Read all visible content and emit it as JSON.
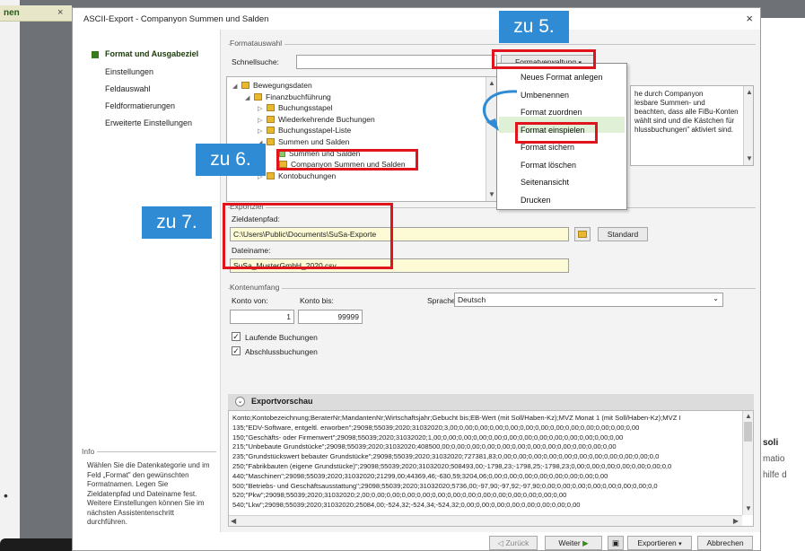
{
  "background_app": {
    "tab_label": "nen",
    "tab_close": "×",
    "right_texts": [
      "soli",
      "matio",
      "hilfe d"
    ]
  },
  "dialog": {
    "title": "ASCII-Export - Companyon Summen und Salden",
    "close": "×"
  },
  "nav": {
    "items": [
      "Format und Ausgabeziel",
      "Einstellungen",
      "Feldauswahl",
      "Feldformatierungen",
      "Erweiterte Einstellungen"
    ],
    "info_title": "Info",
    "info_text": "Wählen Sie die Datenkategorie und im Feld „Format\" den gewünschten Formatnamen. Legen Sie Zieldatenpfad und Dateiname fest. Weitere Einstellungen können Sie im nächsten Assistentenschritt durchführen."
  },
  "format_group": {
    "title": "Formatauswahl",
    "quicksearch_label": "Schnellsuche:",
    "quicksearch_value": "",
    "manager_button": "Formatverwaltung",
    "tree": [
      {
        "label": "Bewegungsdaten",
        "level": 0,
        "icon": "folder",
        "tri": "◢"
      },
      {
        "label": "Finanzbuchführung",
        "level": 1,
        "icon": "folder",
        "tri": "◢"
      },
      {
        "label": "Buchungsstapel",
        "level": 2,
        "icon": "folder",
        "tri": "▷"
      },
      {
        "label": "Wiederkehrende Buchungen",
        "level": 2,
        "icon": "folder",
        "tri": "▷"
      },
      {
        "label": "Buchungsstapel-Liste",
        "level": 2,
        "icon": "folder",
        "tri": "▷"
      },
      {
        "label": "Summen und Salden",
        "level": 2,
        "icon": "folder",
        "tri": "◢"
      },
      {
        "label": "Summen und Salden",
        "level": 3,
        "icon": "doc",
        "tri": ""
      },
      {
        "label": "Companyon Summen und Salden",
        "level": 3,
        "icon": "folder",
        "tri": ""
      },
      {
        "label": "Kontobuchungen",
        "level": 2,
        "icon": "folder",
        "tri": "▷"
      }
    ],
    "description_lines": [
      "he durch Companyon",
      "lesbare Summen- und",
      "beachten, dass alle FiBu-Konten",
      "wählt sind und die Kästchen für",
      "hlussbuchungen\" aktiviert sind."
    ]
  },
  "menu": {
    "items": [
      "Neues Format anlegen",
      "Umbenennen",
      "Format zuordnen",
      "Format einspielen",
      "Format sichern",
      "Format löschen",
      "Seitenansicht",
      "Drucken"
    ]
  },
  "export_group": {
    "title": "Exportziel",
    "path_label": "Zieldatenpfad:",
    "path_value": "C:\\Users\\Public\\Documents\\SuSa-Exporte",
    "standard_button": "Standard",
    "filename_label": "Dateiname:",
    "filename_value": "SuSa_MusterGmbH_2020.csv"
  },
  "account_group": {
    "title": "Kontenumfang",
    "from_label": "Konto von:",
    "to_label": "Konto bis:",
    "from_value": "1",
    "to_value": "99999",
    "language_label": "Sprache:",
    "language_value": "Deutsch",
    "check1": "Laufende Buchungen",
    "check2": "Abschlussbuchungen"
  },
  "preview": {
    "title": "Exportvorschau",
    "lines": [
      "Konto;Kontobezeichnung;BeraterNr;MandantenNr;Wirtschaftsjahr;Gebucht bis;EB-Wert (mit Soll/Haben-Kz);MVZ Monat 1 (mit Soll/Haben-Kz);MVZ I",
      "135;\"EDV-Software, entgeltl. erworben\";29098;55039;2020;31032020;3,00;0,00;0,00;0,00;0,00;0,00;0,00;0,00;0,00;0,00;0,00;0,00;0,00",
      "150;\"Geschäfts- oder Firmenwert\";29098;55039;2020;31032020;1,00;0,00;0,00;0,00;0,00;0,00;0,00;0,00;0,00;0,00;0,00;0,00;0,00",
      "215;\"Unbebaute Grundstücke\";29098;55039;2020;31032020;408500,00;0,00;0,00;0,00;0,00;0,00;0,00;0,00;0,00;0,00;0,00;0,00",
      "235;\"Grundstückswert bebauter Grundstücke\";29098;55039;2020;31032020;727381,83;0,00;0,00;0,00;0,00;0,00;0,00;0,00;0,00;0,00;0,00;0,0",
      "250;\"Fabrikbauten (eigene Grundstücke)\";29098;55039;2020;31032020;508493,00;-1798,23;-1798,25;-1798,23;0,00;0,00;0,00;0,00;0,00;0,00;0,0",
      "440;\"Maschinen\";29098;55039;2020;31032020;21299,00;44369,46;-630,59;3204,06;0,00;0,00;0,00;0,00;0,00;0,00;0,00;0,00",
      "500;\"Betriebs- und Geschäftsausstattung\";29098;55039;2020;31032020;5736,00;-97,90;-97,92;-97,90;0,00;0,00;0,00;0,00;0,00;0,00;0,00;0,0",
      "520;\"Pkw\";29098;55039;2020;31032020;2,00;0,00;0,00;0,00;0,00;0,00;0,00;0,00;0,00;0,00;0,00;0,00;0,00;0,00",
      "540;\"Lkw\";29098;55039;2020;31032020;25084,00;-524,32;-524,34;-524,32;0,00;0,00;0,00;0,00;0,00;0,00;0,00;0,00"
    ]
  },
  "buttons": {
    "back": "◁ Zurück",
    "next": "Weiter",
    "export": "Exportieren",
    "cancel": "Abbrechen"
  },
  "callouts": {
    "c5": "zu 5.",
    "c6": "zu 6.",
    "c7": "zu 7."
  },
  "colors": {
    "callout": "#2e8bd4",
    "highlight_box": "#e0141c",
    "field_yellow": "#fdfbd5"
  }
}
